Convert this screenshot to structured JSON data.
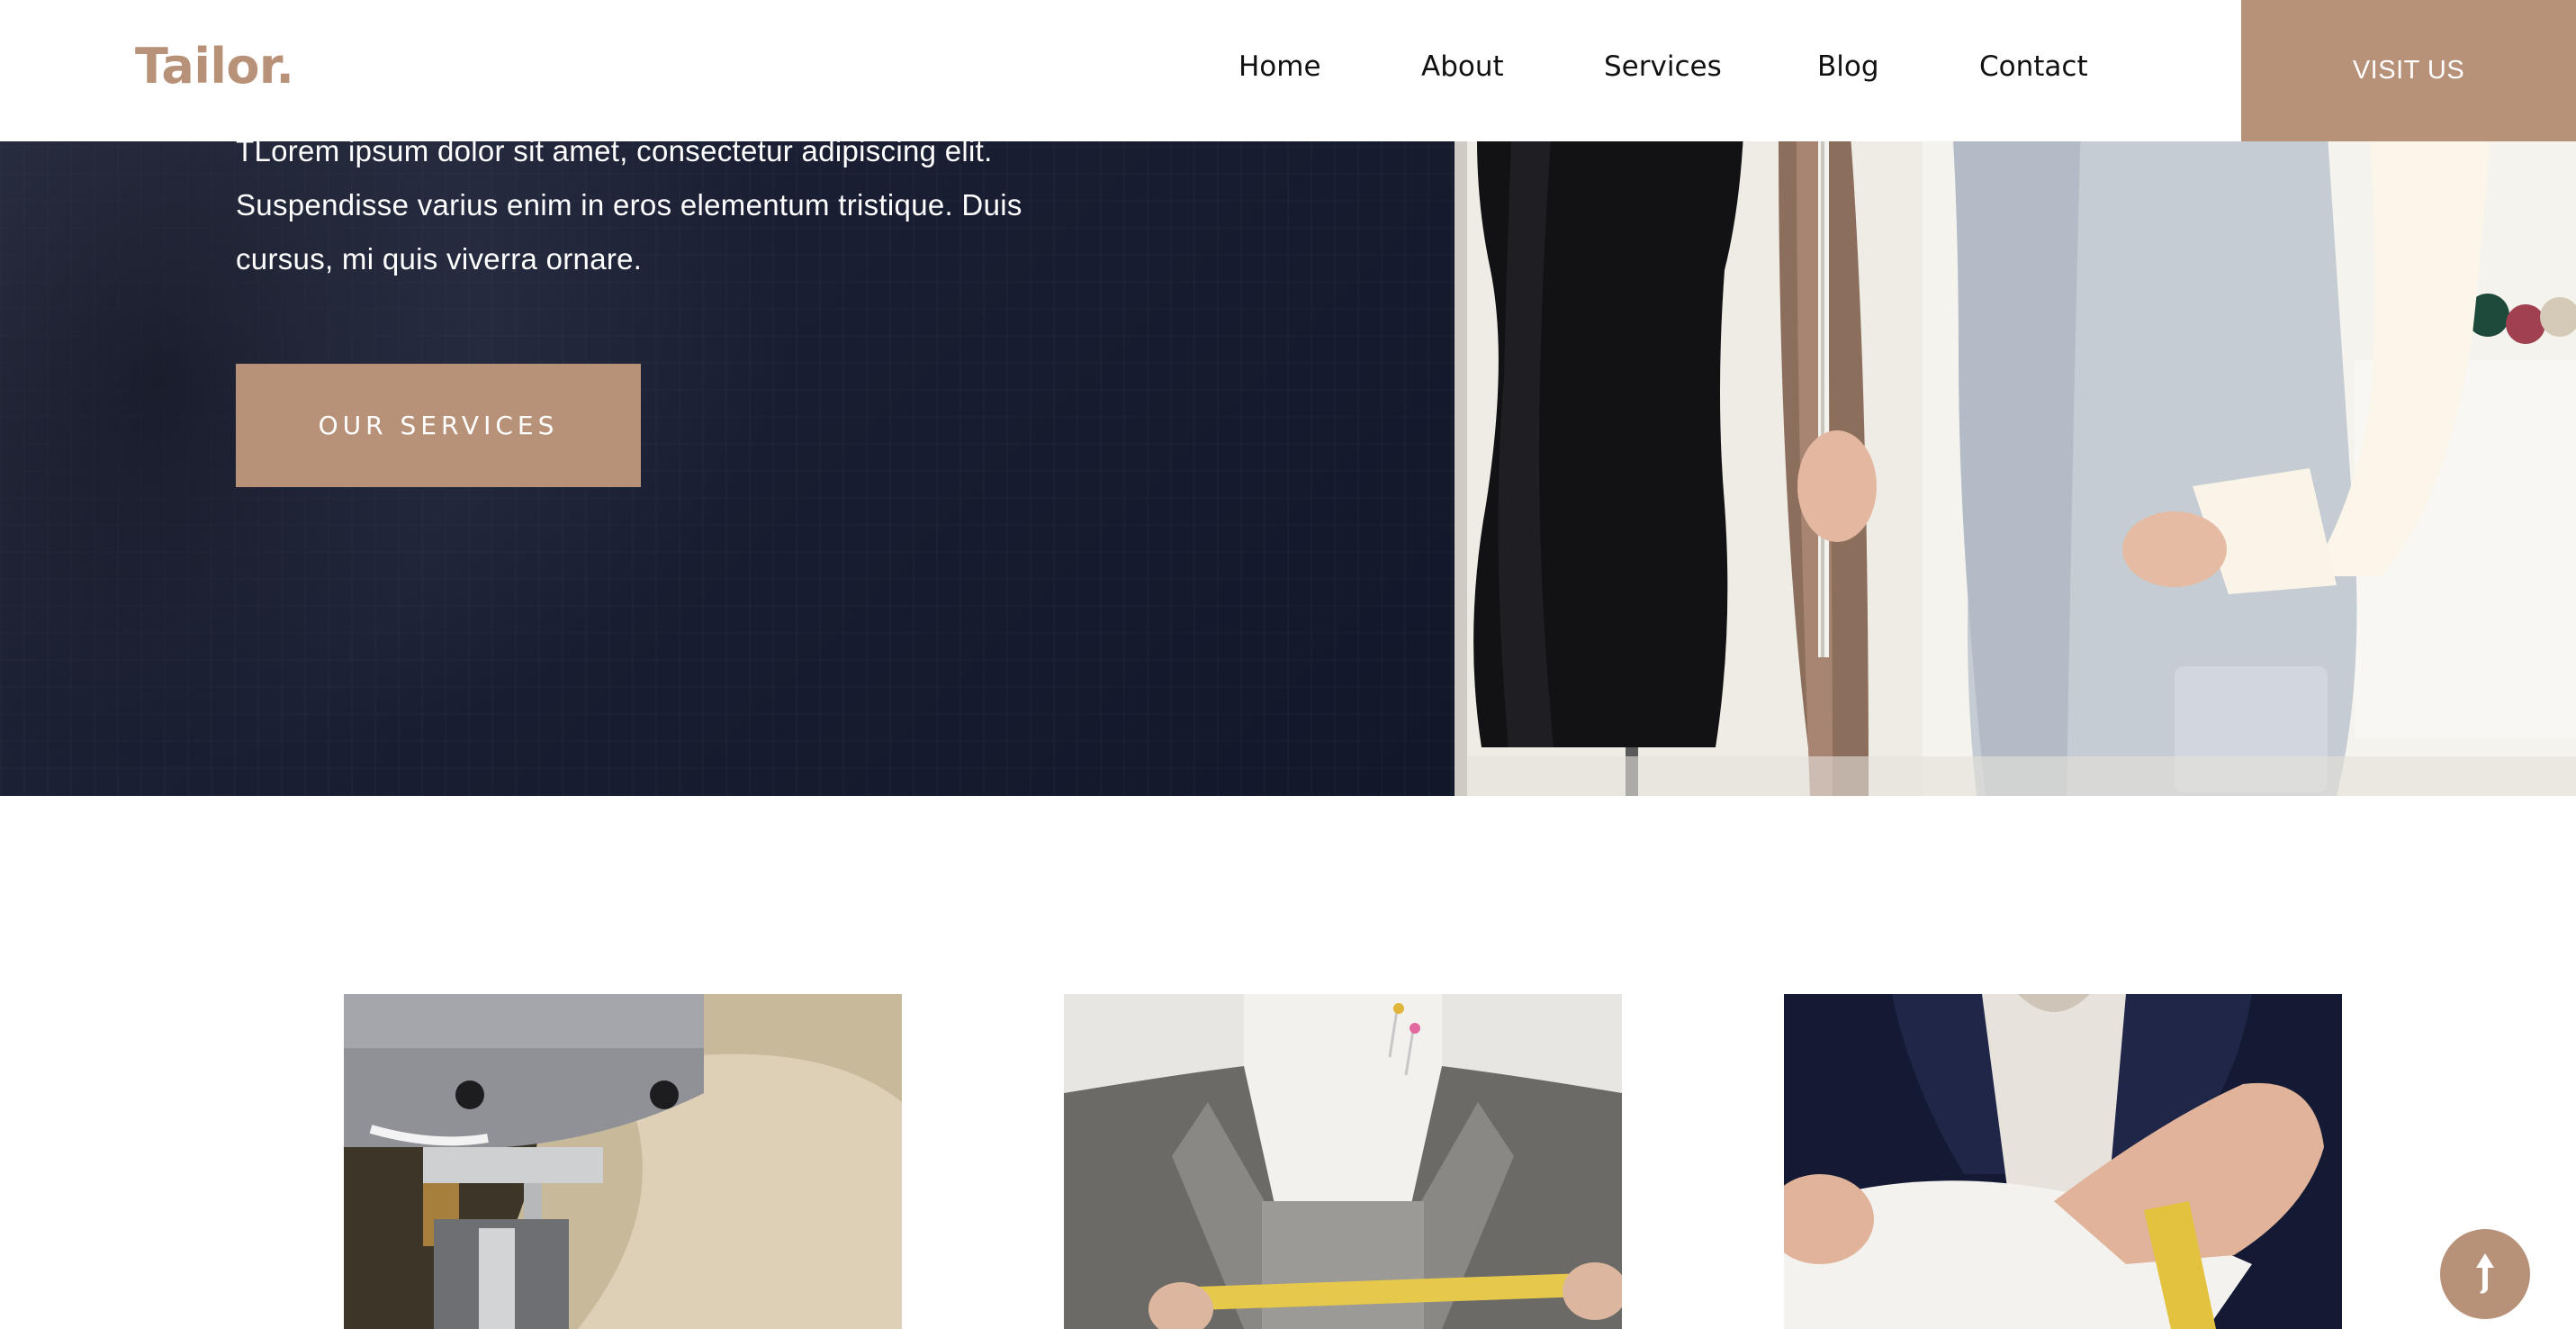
{
  "header": {
    "logo": "Tailor.",
    "nav": [
      {
        "label": "Home"
      },
      {
        "label": "About"
      },
      {
        "label": "Services"
      },
      {
        "label": "Blog"
      },
      {
        "label": "Contact"
      }
    ],
    "visit_label": "VISIT US"
  },
  "hero": {
    "lines": [
      "TLorem ipsum dolor sit amet, consectetur adipiscing elit.",
      "Suspendisse varius enim in eros elementum tristique. Duis",
      "cursus, mi quis viverra ornare."
    ],
    "button_label": "OUR SERVICES"
  },
  "cards": [
    {
      "image": "sewing-machine-photo"
    },
    {
      "image": "mannequin-measuring-photo"
    },
    {
      "image": "cuff-measuring-photo"
    }
  ],
  "icons": {
    "scroll_top": "arrow-up-icon"
  },
  "colors": {
    "accent": "#b89179",
    "hero_bg": "#1a1f33",
    "nav_text": "#111111"
  }
}
